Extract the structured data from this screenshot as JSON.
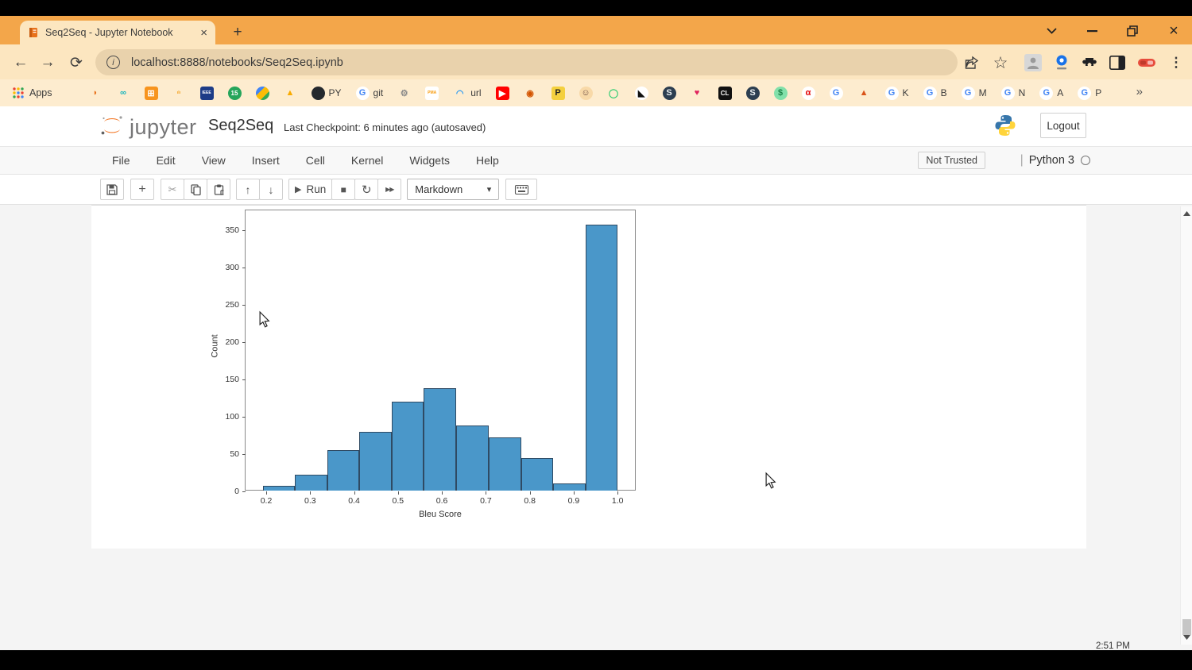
{
  "colors": {
    "titlebar": "#f3a64a",
    "chrome_cream": "#fce6c0",
    "bookmarks_cream": "#fdeccf",
    "urlbar": "#e9d2ac",
    "bar_fill": "#4a97c9",
    "bar_edge": "#2f4a63"
  },
  "browser": {
    "tab_title": "Seq2Seq - Jupyter Notebook",
    "tab_close": "×",
    "new_tab": "+",
    "back": "←",
    "forward": "→",
    "refresh": "⟳",
    "url_info": "i",
    "url": "localhost:8888/notebooks/Seq2Seq.ipynb",
    "star": "☆",
    "kebab": "⋮",
    "minimize": "—",
    "close": "×",
    "bookmarks_label": "Apps",
    "overflow_chevron": "»",
    "bookmarks": [
      {
        "glyph": "◗",
        "bg": "transparent",
        "fg": "#e8721c",
        "round": false,
        "label": ""
      },
      {
        "glyph": "∞",
        "bg": "transparent",
        "fg": "#11b3bd",
        "round": false,
        "label": ""
      },
      {
        "glyph": "⊞",
        "bg": "#f7941e",
        "fg": "#ffffff",
        "round": false,
        "label": ""
      },
      {
        "glyph": "ılı",
        "bg": "transparent",
        "fg": "#f39c12",
        "round": false,
        "label": ""
      },
      {
        "glyph": "IEEE",
        "bg": "#1d3c87",
        "fg": "#ffffff",
        "round": false,
        "label": ""
      },
      {
        "glyph": "15",
        "bg": "#25a55b",
        "fg": "#ffffff",
        "round": true,
        "label": ""
      },
      {
        "glyph": "",
        "bg": "linear-gradient(135deg,#4285f4 0 34%,#fbbc05 34% 67%,#34a853 67% 100%)",
        "fg": "#fff",
        "round": true,
        "label": ""
      },
      {
        "glyph": "▲",
        "bg": "transparent",
        "fg": "#f9ab00",
        "round": false,
        "label": ""
      },
      {
        "glyph": "",
        "bg": "#24292e",
        "fg": "#ffffff",
        "round": true,
        "label": "PY"
      },
      {
        "glyph": "G",
        "bg": "#ffffff",
        "fg": "#4285f4",
        "round": true,
        "label": "git"
      },
      {
        "glyph": "⚙",
        "bg": "transparent",
        "fg": "#8a8a8a",
        "round": false,
        "label": ""
      },
      {
        "glyph": "PMA",
        "bg": "#ffffff",
        "fg": "#f89c0e",
        "round": false,
        "label": ""
      },
      {
        "glyph": "◠",
        "bg": "transparent",
        "fg": "#2196f3",
        "round": false,
        "label": "url"
      },
      {
        "glyph": "▶",
        "bg": "#ff0000",
        "fg": "#ffffff",
        "round": false,
        "label": ""
      },
      {
        "glyph": "◉",
        "bg": "transparent",
        "fg": "#d35400",
        "round": false,
        "label": ""
      },
      {
        "glyph": "P",
        "bg": "#f4d03f",
        "fg": "#222222",
        "round": false,
        "label": ""
      },
      {
        "glyph": "☺",
        "bg": "#f8d9a8",
        "fg": "#6d4c41",
        "round": true,
        "label": ""
      },
      {
        "glyph": "◯",
        "bg": "transparent",
        "fg": "#2ecc71",
        "round": false,
        "label": ""
      },
      {
        "glyph": "◣",
        "bg": "#ffffff",
        "fg": "#111111",
        "round": true,
        "label": ""
      },
      {
        "glyph": "S",
        "bg": "#2c3e50",
        "fg": "#ecf0f1",
        "round": true,
        "label": ""
      },
      {
        "glyph": "♥",
        "bg": "transparent",
        "fg": "#e0245e",
        "round": false,
        "label": ""
      },
      {
        "glyph": "CL",
        "bg": "#111111",
        "fg": "#ffffff",
        "round": false,
        "label": ""
      },
      {
        "glyph": "S",
        "bg": "#2c3e50",
        "fg": "#ecf0f1",
        "round": true,
        "label": ""
      },
      {
        "glyph": "$",
        "bg": "#82e0aa",
        "fg": "#1e8449",
        "round": true,
        "label": ""
      },
      {
        "glyph": "α",
        "bg": "#ffffff",
        "fg": "#e40000",
        "round": true,
        "label": ""
      },
      {
        "glyph": "G",
        "bg": "#ffffff",
        "fg": "#4285f4",
        "round": true,
        "label": ""
      },
      {
        "glyph": "▲",
        "bg": "transparent",
        "fg": "#d95319",
        "round": false,
        "label": ""
      },
      {
        "glyph": "G",
        "bg": "#ffffff",
        "fg": "#4285f4",
        "round": true,
        "label": "K"
      },
      {
        "glyph": "G",
        "bg": "#ffffff",
        "fg": "#4285f4",
        "round": true,
        "label": "B"
      },
      {
        "glyph": "G",
        "bg": "#ffffff",
        "fg": "#4285f4",
        "round": true,
        "label": "M"
      },
      {
        "glyph": "G",
        "bg": "#ffffff",
        "fg": "#4285f4",
        "round": true,
        "label": "N"
      },
      {
        "glyph": "G",
        "bg": "#ffffff",
        "fg": "#4285f4",
        "round": true,
        "label": "A"
      },
      {
        "glyph": "G",
        "bg": "#ffffff",
        "fg": "#4285f4",
        "round": true,
        "label": "P"
      }
    ]
  },
  "jupyter": {
    "logo_text": "jupyter",
    "notebook_title": "Seq2Seq",
    "checkpoint": "Last Checkpoint: 6 minutes ago  (autosaved)",
    "logout_label": "Logout",
    "menu": [
      "File",
      "Edit",
      "View",
      "Insert",
      "Cell",
      "Kernel",
      "Widgets",
      "Help"
    ],
    "trust_badge": "Not Trusted",
    "kernel_name": "Python 3",
    "toolbar": {
      "add": "+",
      "cut": "✂",
      "up": "↑",
      "down": "↓",
      "run_glyph": "▶",
      "run_label": "Run",
      "stop": "■",
      "restart": "↻",
      "ff": "▶▶",
      "cell_type": "Markdown",
      "select_chevron": "▾"
    }
  },
  "chart_data": {
    "type": "bar",
    "subtype": "histogram",
    "title": "",
    "xlabel": "Bleu Score",
    "ylabel": "Count",
    "xlim": [
      0.153,
      1.043
    ],
    "ylim": [
      0,
      376
    ],
    "xticks": [
      0.2,
      0.3,
      0.4,
      0.5,
      0.6,
      0.7,
      0.8,
      0.9,
      1.0
    ],
    "yticks": [
      0,
      50,
      100,
      150,
      200,
      250,
      300,
      350
    ],
    "grid": false,
    "legend": "none",
    "bins": [
      {
        "x0": 0.192,
        "x1": 0.265,
        "count": 8
      },
      {
        "x0": 0.265,
        "x1": 0.339,
        "count": 22
      },
      {
        "x0": 0.339,
        "x1": 0.412,
        "count": 55
      },
      {
        "x0": 0.412,
        "x1": 0.486,
        "count": 80
      },
      {
        "x0": 0.486,
        "x1": 0.559,
        "count": 120
      },
      {
        "x0": 0.559,
        "x1": 0.633,
        "count": 138
      },
      {
        "x0": 0.633,
        "x1": 0.706,
        "count": 88
      },
      {
        "x0": 0.706,
        "x1": 0.78,
        "count": 72
      },
      {
        "x0": 0.78,
        "x1": 0.853,
        "count": 45
      },
      {
        "x0": 0.853,
        "x1": 0.927,
        "count": 11
      },
      {
        "x0": 0.927,
        "x1": 1.0,
        "count": 357
      }
    ]
  },
  "misc": {
    "clock_partial": "2:51 PM"
  }
}
